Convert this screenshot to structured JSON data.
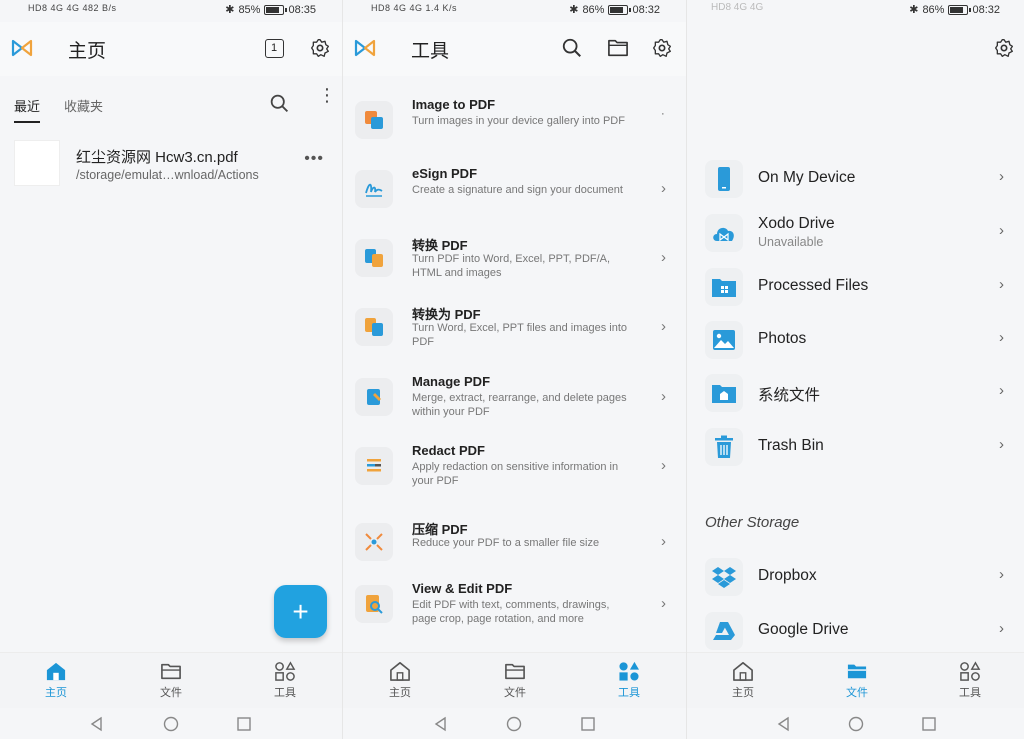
{
  "colors": {
    "accent": "#1b95d6",
    "fab": "#21a2e0",
    "orange": "#f0a33c",
    "blue": "#2a9ad9"
  },
  "screen1": {
    "status": {
      "left": "HD8 4G 4G 482 B/s",
      "battery": "85%",
      "time": "08:35"
    },
    "title": "主页",
    "tab_count": "1",
    "tabs": [
      "最近",
      "收藏夹"
    ],
    "file": {
      "name": "红尘资源网 Hcw3.cn.pdf",
      "path": "/storage/emulat…wnload/Actions"
    },
    "fab_label": "+",
    "nav": [
      "主页",
      "文件",
      "工具"
    ]
  },
  "screen2": {
    "status": {
      "left": "HD8 4G 4G 1.4 K/s",
      "battery": "86%",
      "time": "08:32"
    },
    "title": "工具",
    "tools": [
      {
        "title": "Image to PDF",
        "desc": "Turn images in your device gallery into PDF",
        "icon": "image-to-pdf-icon",
        "chevron": "˙"
      },
      {
        "title": "eSign PDF",
        "desc": "Create a signature and sign your document",
        "icon": "esign-icon",
        "chevron": "›"
      },
      {
        "title": "转换 PDF",
        "desc": "Turn PDF into Word, Excel, PPT, PDF/A, HTML and images",
        "icon": "convert-pdf-icon",
        "chevron": "›"
      },
      {
        "title": "转换为 PDF",
        "desc": "Turn Word, Excel, PPT files and images into PDF",
        "icon": "convert-to-pdf-icon",
        "chevron": "›"
      },
      {
        "title": "Manage PDF",
        "desc": "Merge, extract, rearrange, and delete pages within your PDF",
        "icon": "manage-pdf-icon",
        "chevron": "›"
      },
      {
        "title": "Redact PDF",
        "desc": "Apply redaction on sensitive information in your PDF",
        "icon": "redact-icon",
        "chevron": "›"
      },
      {
        "title": "压缩 PDF",
        "desc": "Reduce your PDF to a smaller file size",
        "icon": "compress-icon",
        "chevron": "›"
      },
      {
        "title": "View & Edit PDF",
        "desc": "Edit PDF with text, comments, drawings, page crop, page rotation, and more",
        "icon": "view-edit-icon",
        "chevron": "›"
      }
    ],
    "nav": [
      "主页",
      "文件",
      "工具"
    ]
  },
  "screen3": {
    "status": {
      "left": "HD8 4G 4G",
      "battery": "86%",
      "time": "08:32"
    },
    "locations": [
      {
        "label": "On My Device",
        "sub": "",
        "icon": "phone-icon"
      },
      {
        "label": "Xodo Drive",
        "sub": "Unavailable",
        "icon": "cloud-icon"
      },
      {
        "label": "Processed Files",
        "sub": "",
        "icon": "processed-folder-icon"
      },
      {
        "label": "Photos",
        "sub": "",
        "icon": "photo-icon"
      },
      {
        "label": "系统文件",
        "sub": "",
        "icon": "system-folder-icon"
      },
      {
        "label": "Trash Bin",
        "sub": "",
        "icon": "trash-icon"
      }
    ],
    "other_storage_title": "Other Storage",
    "other": [
      {
        "label": "Dropbox",
        "icon": "dropbox-icon"
      },
      {
        "label": "Google Drive",
        "icon": "google-drive-icon"
      }
    ],
    "nav": [
      "主页",
      "文件",
      "工具"
    ]
  }
}
